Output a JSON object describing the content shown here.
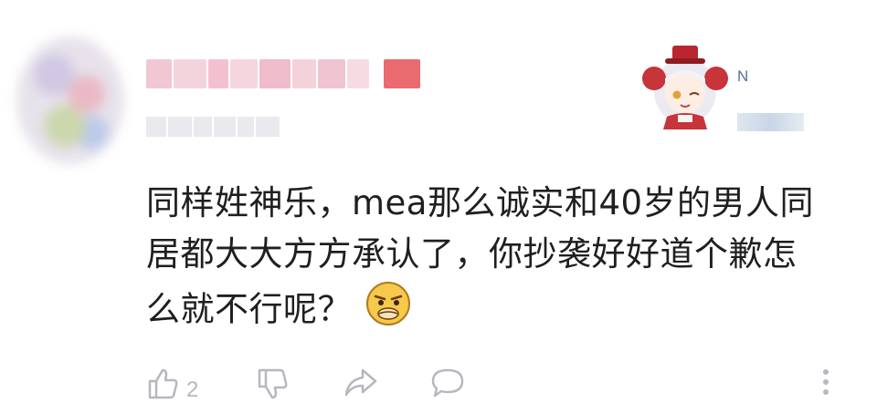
{
  "comment": {
    "lines": [
      "同样姓神乐，mea那么诚实和40岁的男人同",
      "居都大大方方承认了，你抄袭好好道个歉怎",
      "么就不行呢？"
    ]
  },
  "badge": {
    "text": "N"
  },
  "actions": {
    "like_count": "2"
  },
  "icons": {
    "like": "thumb-up-icon",
    "dislike": "thumb-down-icon",
    "share": "share-arrow-icon",
    "reply": "comment-bubble-icon",
    "more": "more-vertical-icon",
    "emoji": "smirk-emoji-icon"
  },
  "colors": {
    "icon_gray": "#b7b7bf",
    "text": "#1f1f1f",
    "badge_text": "#5a6f96"
  }
}
